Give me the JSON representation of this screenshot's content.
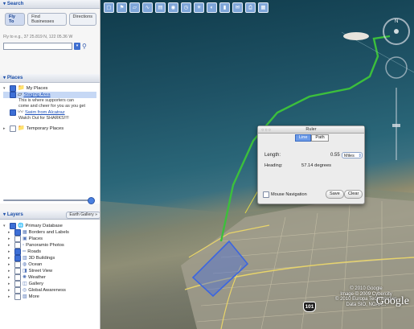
{
  "search": {
    "title": "▾ Search",
    "tabs": [
      "Fly To",
      "Find Businesses",
      "Directions"
    ],
    "hint": "Fly to e.g., 37 25.819 N, 122 05.36 W",
    "input_value": ""
  },
  "places": {
    "title": "▾ Places",
    "my_places": "My Places",
    "staging_area": "Staging Area",
    "staging_desc_1": "This is where supporters can",
    "staging_desc_2": "come and cheer for you as you get",
    "swim": "Swim from Alcatraz",
    "swim_desc": "Watch Out for SHARKS!!!!",
    "temporary": "Temporary Places"
  },
  "layers": {
    "title": "▾ Layers",
    "gallery_label": "Earth Gallery »",
    "items": [
      {
        "label": "Primary Database",
        "indent": 0,
        "checked": true,
        "icon": "globe-icon"
      },
      {
        "label": "Borders and Labels",
        "indent": 1,
        "checked": true,
        "icon": "borders-icon"
      },
      {
        "label": "Places",
        "indent": 1,
        "checked": false,
        "icon": "places-icon"
      },
      {
        "label": "Panoramio Photos",
        "indent": 1,
        "checked": false,
        "icon": "photo-icon"
      },
      {
        "label": "Roads",
        "indent": 1,
        "checked": true,
        "icon": "road-icon"
      },
      {
        "label": "3D Buildings",
        "indent": 1,
        "checked": true,
        "icon": "building-icon"
      },
      {
        "label": "Ocean",
        "indent": 1,
        "checked": false,
        "icon": "ocean-icon"
      },
      {
        "label": "Street View",
        "indent": 1,
        "checked": false,
        "icon": "street-view-icon"
      },
      {
        "label": "Weather",
        "indent": 1,
        "checked": false,
        "icon": "weather-icon"
      },
      {
        "label": "Gallery",
        "indent": 1,
        "checked": false,
        "icon": "gallery-icon"
      },
      {
        "label": "Global Awareness",
        "indent": 1,
        "checked": false,
        "icon": "awareness-icon"
      },
      {
        "label": "More",
        "indent": 1,
        "checked": false,
        "icon": "more-icon"
      }
    ]
  },
  "ruler": {
    "title": "Ruler",
    "tab_line": "Line",
    "tab_path": "Path",
    "length_label": "Length:",
    "length_value": "0.55",
    "unit": "Miles",
    "heading_label": "Heading:",
    "heading_value": "57.14 degrees",
    "mouse_nav": "Mouse Navigation",
    "save": "Save",
    "clear": "Clear"
  },
  "map": {
    "copyright_1": "© 2010 Google",
    "copyright_2": "Image © 2009 Cybercity",
    "copyright_3": "© 2010 Europa Technologies",
    "copyright_4": "Data SIO, NOAA...",
    "logo": "Google",
    "route_shield": "101"
  }
}
